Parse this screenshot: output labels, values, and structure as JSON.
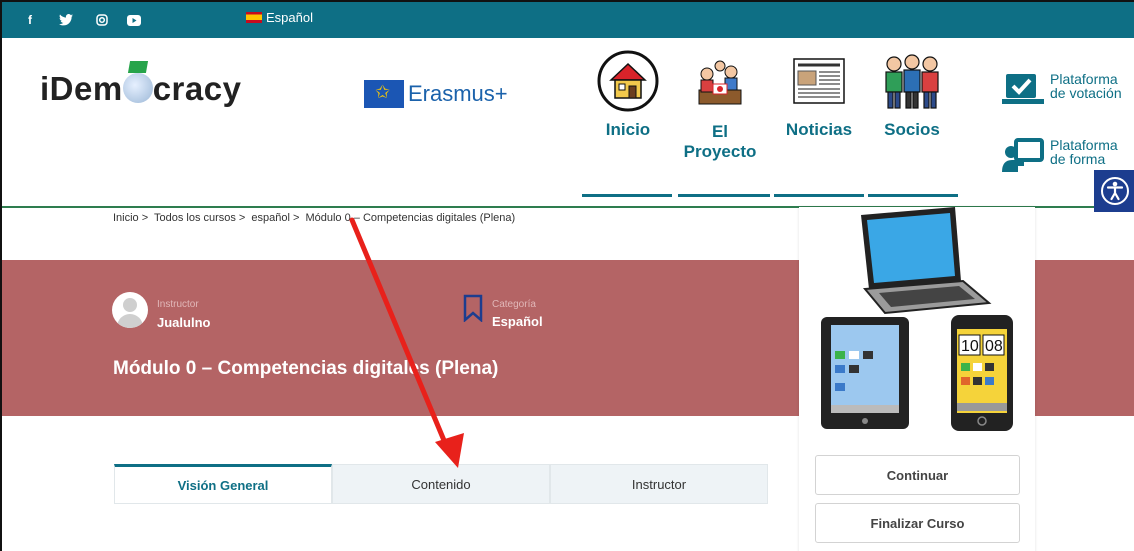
{
  "topbar": {
    "social": [
      {
        "name": "facebook-icon",
        "glyph": "f"
      },
      {
        "name": "twitter-icon",
        "glyph": "♥"
      },
      {
        "name": "instagram-icon",
        "glyph": "◎"
      },
      {
        "name": "youtube-icon",
        "glyph": "▶"
      }
    ],
    "language": "Español"
  },
  "header": {
    "logo_text_before": "iDem",
    "logo_text_after": "cracy",
    "erasmus": "Erasmus+",
    "nav": [
      {
        "label": "Inicio"
      },
      {
        "label": "El Proyecto"
      },
      {
        "label": "Noticias"
      },
      {
        "label": "Socios"
      }
    ],
    "side": [
      {
        "label": "Plataforma de votación"
      },
      {
        "label": "Plataforma de forma"
      }
    ]
  },
  "breadcrumb": [
    "Inicio",
    "Todos los cursos",
    "español",
    "Módulo 0 – Competencias digitales (Plena)"
  ],
  "breadcrumb_sep": ">",
  "course": {
    "instructor_label": "Instructor",
    "instructor_name": "Jualulno",
    "category_label": "Categoría",
    "category_value": "Español",
    "title": "Módulo 0 – Competencias digitales (Plena)"
  },
  "card": {
    "continue_label": "Continuar",
    "finish_label": "Finalizar Curso",
    "tablet_time": "10 08"
  },
  "tabs": [
    {
      "label": "Visión General",
      "active": true
    },
    {
      "label": "Contenido",
      "active": false
    },
    {
      "label": "Instructor",
      "active": false
    }
  ],
  "colors": {
    "brand": "#0e6f85",
    "hero": "#b46465",
    "annotation": "#e8211b"
  }
}
